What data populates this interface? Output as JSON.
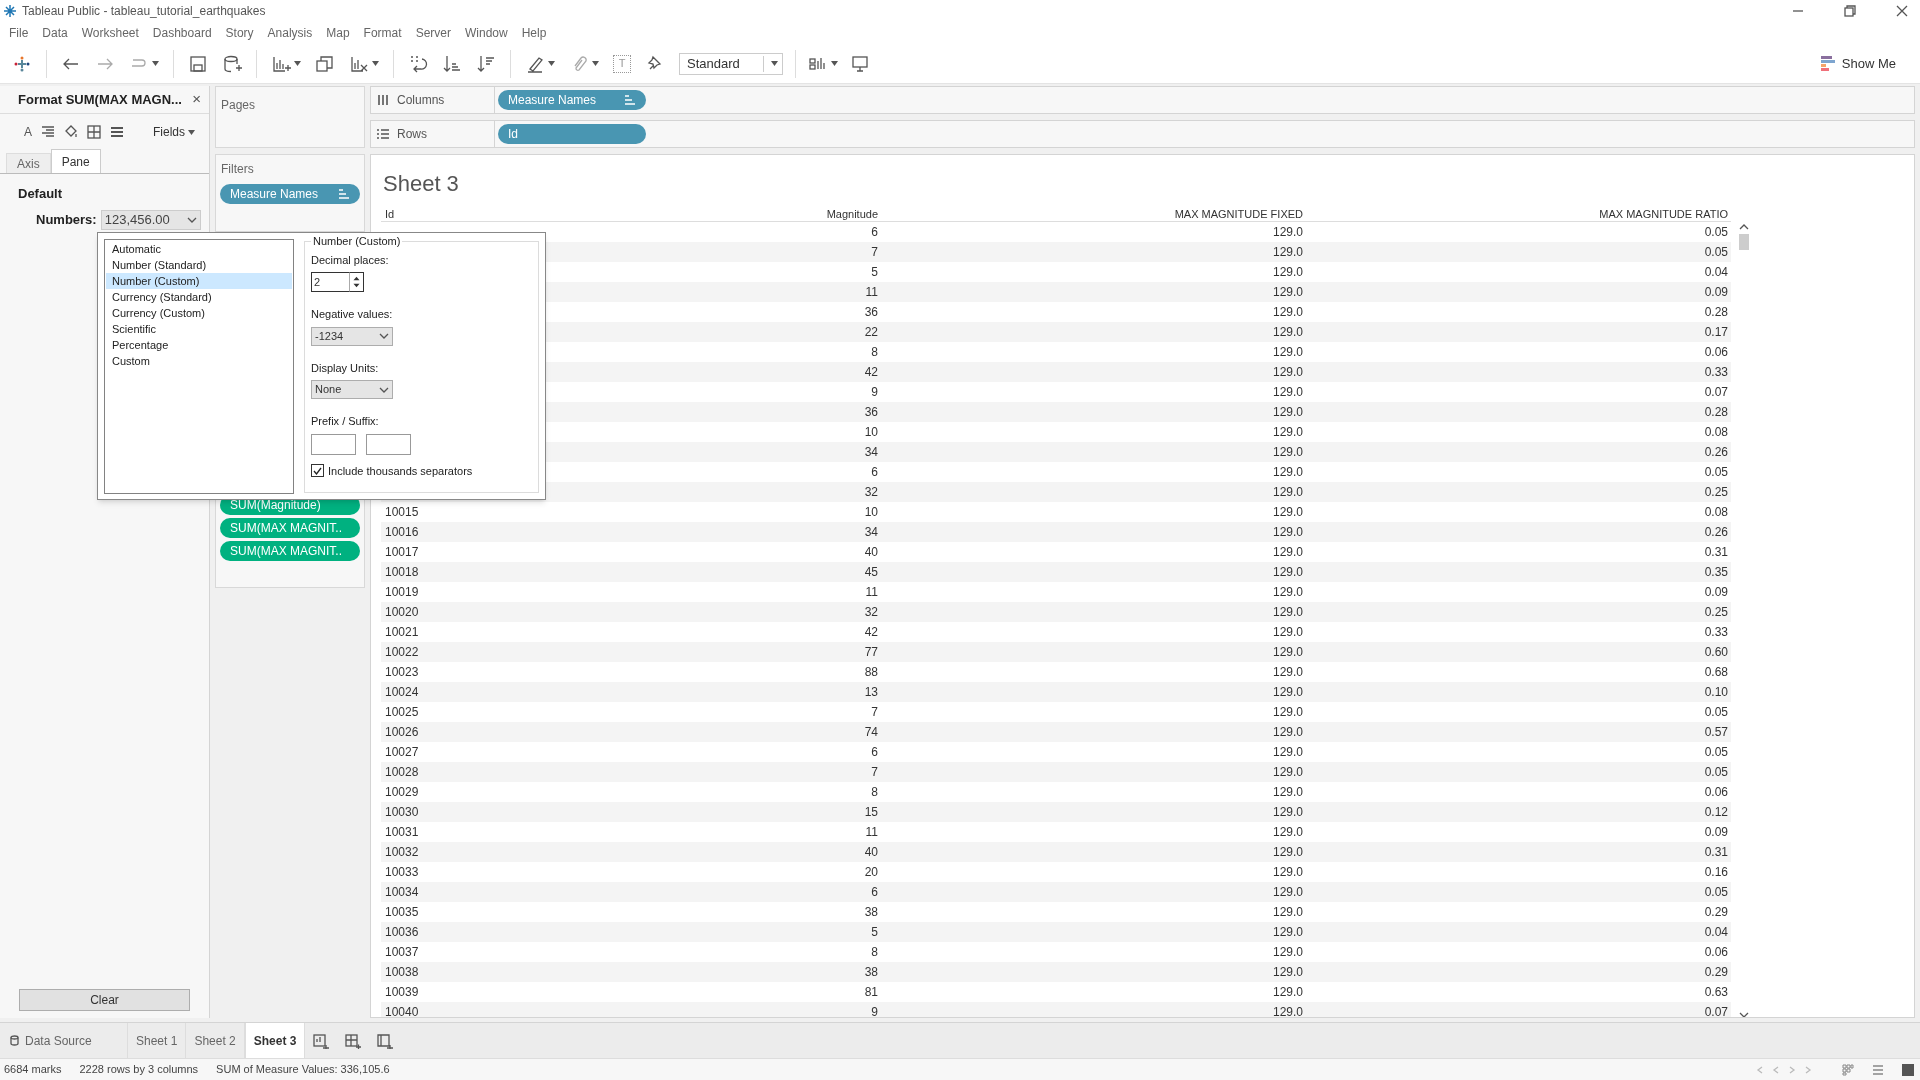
{
  "window": {
    "title": "Tableau Public - tableau_tutorial_earthquakes"
  },
  "menu": [
    "File",
    "Data",
    "Worksheet",
    "Dashboard",
    "Story",
    "Analysis",
    "Map",
    "Format",
    "Server",
    "Window",
    "Help"
  ],
  "toolbar": {
    "label_icon": "T",
    "fit": "Standard",
    "show_me": "Show Me"
  },
  "format_pane": {
    "title": "Format SUM(MAX MAGN...",
    "close": "×",
    "font_icon": "A",
    "fields": "Fields",
    "tabs": [
      {
        "label": "Axis",
        "selected": false
      },
      {
        "label": "Pane",
        "selected": true
      }
    ],
    "section": "Default",
    "numbers_label": "Numbers:",
    "numbers_value": "123,456.00",
    "clear": "Clear"
  },
  "number_format_popup": {
    "formats": [
      {
        "label": "Automatic",
        "selected": false
      },
      {
        "label": "Number (Standard)",
        "selected": false
      },
      {
        "label": "Number (Custom)",
        "selected": true
      },
      {
        "label": "Currency (Standard)",
        "selected": false
      },
      {
        "label": "Currency (Custom)",
        "selected": false
      },
      {
        "label": "Scientific",
        "selected": false
      },
      {
        "label": "Percentage",
        "selected": false
      },
      {
        "label": "Custom",
        "selected": false
      }
    ],
    "group_title": "Number (Custom)",
    "decimal_label": "Decimal places:",
    "decimal_value": "2",
    "negative_label": "Negative values:",
    "negative_value": "-1234",
    "units_label": "Display Units:",
    "units_value": "None",
    "prefix_label": "Prefix / Suffix:",
    "thousands": {
      "label": "Include thousands separators",
      "checked": true
    }
  },
  "pages": {
    "title": "Pages"
  },
  "filters": {
    "title": "Filters",
    "pills": [
      "Measure Names"
    ]
  },
  "marks": {
    "pills": [
      "SUM(Magnitude)",
      "SUM(MAX MAGNIT..",
      "SUM(MAX MAGNIT.."
    ]
  },
  "shelves": [
    {
      "kind": "columns",
      "label": "Columns",
      "pill": "Measure Names"
    },
    {
      "kind": "rows",
      "label": "Rows",
      "pill": "Id"
    }
  ],
  "sheet": {
    "title": "Sheet 3",
    "columns": [
      "Id",
      "Magnitude",
      "MAX MAGNITUDE FIXED",
      "MAX MAGNITUDE RATIO"
    ],
    "rows": [
      [
        null,
        "6",
        "129.0",
        "0.05"
      ],
      [
        null,
        "7",
        "129.0",
        "0.05"
      ],
      [
        null,
        "5",
        "129.0",
        "0.04"
      ],
      [
        null,
        "11",
        "129.0",
        "0.09"
      ],
      [
        null,
        "36",
        "129.0",
        "0.28"
      ],
      [
        null,
        "22",
        "129.0",
        "0.17"
      ],
      [
        null,
        "8",
        "129.0",
        "0.06"
      ],
      [
        null,
        "42",
        "129.0",
        "0.33"
      ],
      [
        null,
        "9",
        "129.0",
        "0.07"
      ],
      [
        null,
        "36",
        "129.0",
        "0.28"
      ],
      [
        null,
        "10",
        "129.0",
        "0.08"
      ],
      [
        null,
        "34",
        "129.0",
        "0.26"
      ],
      [
        null,
        "6",
        "129.0",
        "0.05"
      ],
      [
        null,
        "32",
        "129.0",
        "0.25"
      ],
      [
        "10015",
        "10",
        "129.0",
        "0.08"
      ],
      [
        "10016",
        "34",
        "129.0",
        "0.26"
      ],
      [
        "10017",
        "40",
        "129.0",
        "0.31"
      ],
      [
        "10018",
        "45",
        "129.0",
        "0.35"
      ],
      [
        "10019",
        "11",
        "129.0",
        "0.09"
      ],
      [
        "10020",
        "32",
        "129.0",
        "0.25"
      ],
      [
        "10021",
        "42",
        "129.0",
        "0.33"
      ],
      [
        "10022",
        "77",
        "129.0",
        "0.60"
      ],
      [
        "10023",
        "88",
        "129.0",
        "0.68"
      ],
      [
        "10024",
        "13",
        "129.0",
        "0.10"
      ],
      [
        "10025",
        "7",
        "129.0",
        "0.05"
      ],
      [
        "10026",
        "74",
        "129.0",
        "0.57"
      ],
      [
        "10027",
        "6",
        "129.0",
        "0.05"
      ],
      [
        "10028",
        "7",
        "129.0",
        "0.05"
      ],
      [
        "10029",
        "8",
        "129.0",
        "0.06"
      ],
      [
        "10030",
        "15",
        "129.0",
        "0.12"
      ],
      [
        "10031",
        "11",
        "129.0",
        "0.09"
      ],
      [
        "10032",
        "40",
        "129.0",
        "0.31"
      ],
      [
        "10033",
        "20",
        "129.0",
        "0.16"
      ],
      [
        "10034",
        "6",
        "129.0",
        "0.05"
      ],
      [
        "10035",
        "38",
        "129.0",
        "0.29"
      ],
      [
        "10036",
        "5",
        "129.0",
        "0.04"
      ],
      [
        "10037",
        "8",
        "129.0",
        "0.06"
      ],
      [
        "10038",
        "38",
        "129.0",
        "0.29"
      ],
      [
        "10039",
        "81",
        "129.0",
        "0.63"
      ],
      [
        "10040",
        "9",
        "129.0",
        "0.07"
      ]
    ]
  },
  "sheet_tabs": [
    {
      "kind": "datasource",
      "label": "Data Source",
      "selected": false
    },
    {
      "kind": "sheet",
      "label": "Sheet 1",
      "selected": false
    },
    {
      "kind": "sheet",
      "label": "Sheet 2",
      "selected": false
    },
    {
      "kind": "sheet",
      "label": "Sheet 3",
      "selected": true
    }
  ],
  "status_bar": [
    "6684 marks",
    "2228 rows by 3 columns",
    "SUM of Measure Values: 336,105.6"
  ]
}
